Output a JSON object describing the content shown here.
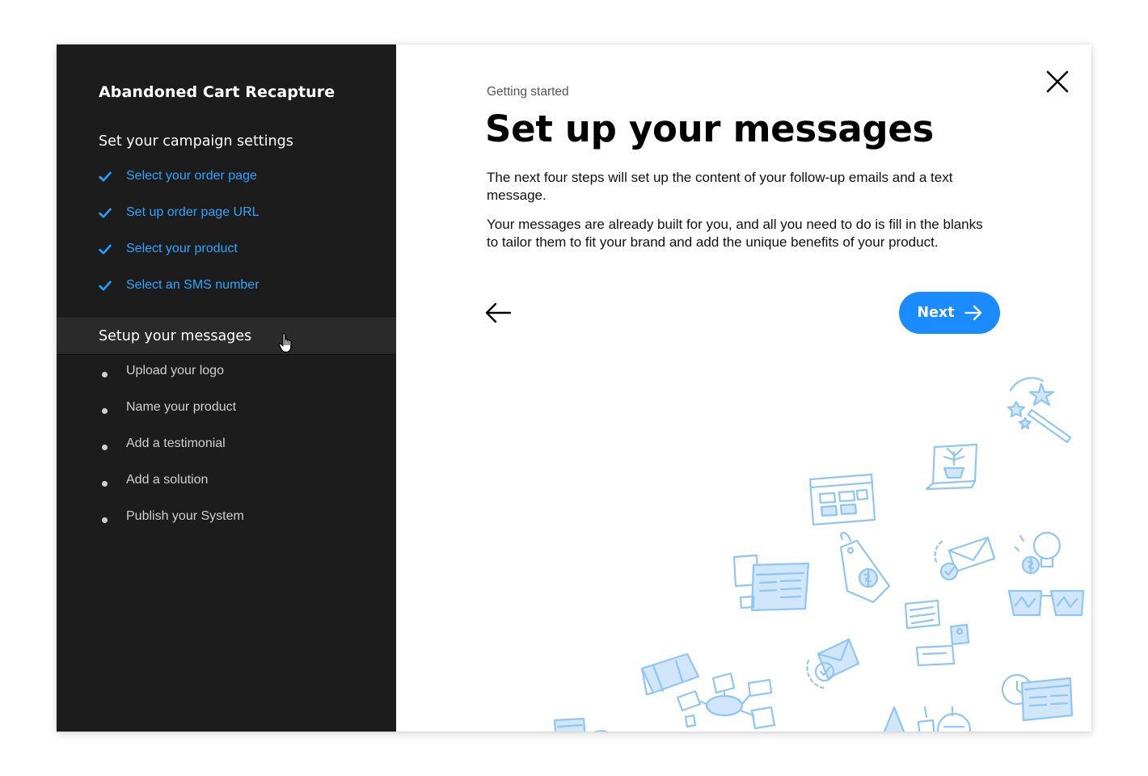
{
  "sidebar": {
    "app_title": "Abandoned Cart Recapture",
    "section_campaign": "Set your campaign settings",
    "completed_steps": [
      {
        "label": "Select your order page"
      },
      {
        "label": "Set up order page URL"
      },
      {
        "label": "Select your product"
      },
      {
        "label": "Select an SMS number"
      }
    ],
    "section_messages": "Setup your messages",
    "pending_steps": [
      {
        "label": "Upload your logo"
      },
      {
        "label": "Name your product"
      },
      {
        "label": "Add a testimonial"
      },
      {
        "label": "Add a solution"
      },
      {
        "label": "Publish your System"
      }
    ]
  },
  "main": {
    "breadcrumb": "Getting started",
    "title": "Set up your messages",
    "paragraph_1": "The next four steps will set up the content of your follow-up emails and a text message.",
    "paragraph_2": "Your messages are already built for you, and all you need to do is fill in the blanks to tailor them to fit your brand and add the unique benefits of your product.",
    "next_label": "Next"
  },
  "icons": {
    "close": "close-icon",
    "back": "arrow-left-icon",
    "next": "arrow-right-icon",
    "completed_step": "checkmark-icon",
    "pending_step": "bullet-icon",
    "cursor": "hand-pointer-icon"
  },
  "colors": {
    "sidebar_bg": "#1c1c1c",
    "active_row_bg": "#2a2a2a",
    "completed_text": "#29a5ff",
    "check": "#1ea1ff",
    "accent": "#1a8cff",
    "illustration": "#8fc6f7"
  }
}
